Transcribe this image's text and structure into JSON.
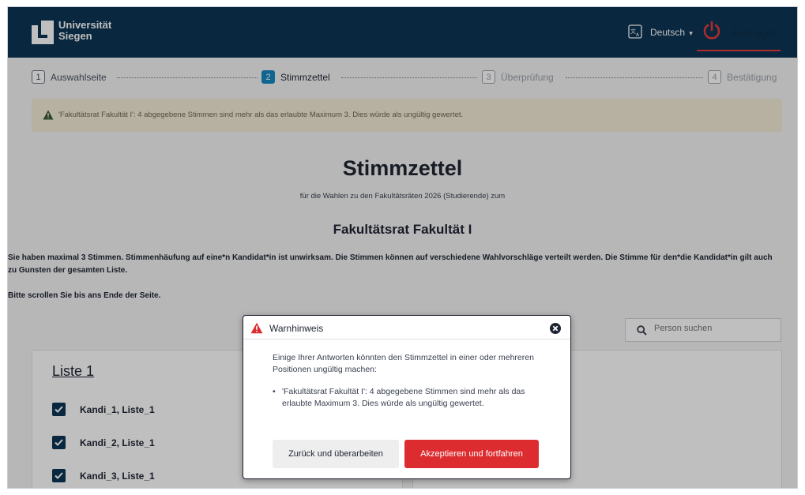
{
  "header": {
    "logo_line1": "Universität",
    "logo_line2": "Siegen",
    "language": "Deutsch",
    "language_caret": "▾",
    "logout_label": "Ausloggen"
  },
  "stepper": {
    "steps": [
      {
        "num": "1",
        "label": "Auswahlseite"
      },
      {
        "num": "2",
        "label": "Stimmzettel"
      },
      {
        "num": "3",
        "label": "Überprüfung"
      },
      {
        "num": "4",
        "label": "Bestätigung"
      }
    ]
  },
  "banner": {
    "text": "'Fakultätsrat Fakultät I': 4 abgegebene Stimmen sind mehr als das erlaubte Maximum 3. Dies würde als ungültig gewertet."
  },
  "ballot": {
    "title": "Stimmzettel",
    "subtitle": "für die Wahlen zu den Fakultätsräten 2026 (Studierende) zum",
    "faculty": "Fakultätsrat Fakultät I",
    "intro": "Sie haben maximal 3 Stimmen. Stimmenhäufung auf eine*n Kandidat*in ist unwirksam. Die Stimmen können auf verschiedene Wahlvorschläge verteilt werden. Die Stimme für den*die Kandidat*in gilt auch zu Gunsten der gesamten Liste.",
    "scroll_note": "Bitte scrollen Sie bis ans Ende der Seite."
  },
  "search": {
    "placeholder": "Person suchen"
  },
  "list1": {
    "title": "Liste 1",
    "candidates": [
      {
        "name": "Kandi_1, Liste_1",
        "checked": true
      },
      {
        "name": "Kandi_2, Liste_1",
        "checked": true
      },
      {
        "name": "Kandi_3, Liste_1",
        "checked": true
      }
    ]
  },
  "modal": {
    "title": "Warnhinweis",
    "body": "Einige Ihrer Antworten könnten den Stimmzettel in einer oder mehreren Positionen ungültig machen:",
    "bullet": "•",
    "item": "'Fakultätsrat Fakultät I': 4 abgegebene Stimmen sind mehr als das erlaubte Maximum 3. Dies würde als ungültig gewertet.",
    "back_label": "Zurück und überarbeiten",
    "accept_label": "Akzeptieren und fortfahren"
  },
  "colors": {
    "header_bg": "#0c3554",
    "active_step": "#1787c2",
    "warning_bg": "#f3ecd7",
    "accept_button": "#dd2c30",
    "warning_icon": "#dd2c30"
  }
}
